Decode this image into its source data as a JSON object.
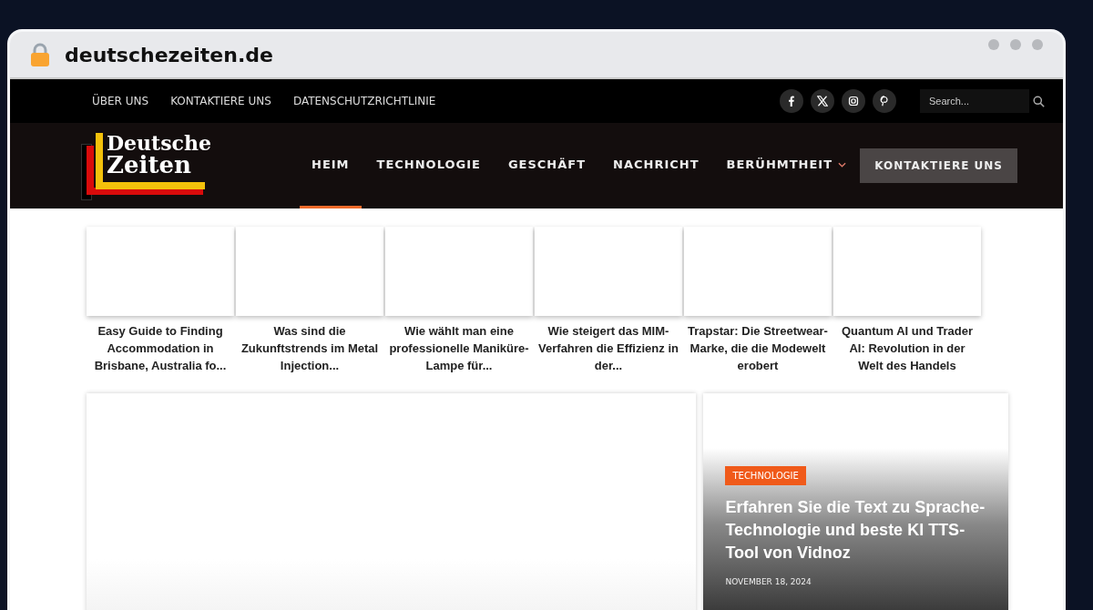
{
  "browser": {
    "address": "deutschezeiten.de"
  },
  "top_bar": {
    "links": [
      "ÜBER UNS",
      "KONTAKTIERE UNS",
      "DATENSCHUTZRICHTLINIE"
    ],
    "social": [
      {
        "kind": "facebook"
      },
      {
        "kind": "x"
      },
      {
        "kind": "instagram"
      },
      {
        "kind": "pinterest"
      }
    ],
    "search": {
      "placeholder": "Search..."
    }
  },
  "header": {
    "logo": [
      "Deutsche",
      "Zeiten"
    ],
    "nav": [
      {
        "label": "HEIM",
        "selected": true,
        "has_menu": false
      },
      {
        "label": "TECHNOLOGIE",
        "selected": false,
        "has_menu": false
      },
      {
        "label": "GESCHÄFT",
        "selected": false,
        "has_menu": false
      },
      {
        "label": "NACHRICHT",
        "selected": false,
        "has_menu": false
      },
      {
        "label": "BERÜHMTHEIT",
        "selected": false,
        "has_menu": true
      }
    ],
    "cta": "KONTAKTIERE UNS"
  },
  "carousel": [
    {
      "title": "Easy Guide to Finding Accommodation in Brisbane, Australia fo..."
    },
    {
      "title": "Was sind die Zukunftstrends im Metal Injection..."
    },
    {
      "title": "Wie wählt man eine professionelle Maniküre-Lampe für..."
    },
    {
      "title": "Wie steigert das MIM-Verfahren die Effizienz in der..."
    },
    {
      "title": "Trapstar: Die Streetwear-Marke, die die Modewelt erobert"
    },
    {
      "title": "Quantum AI und Trader AI: Revolution in der Welt des Handels"
    }
  ],
  "featured": {
    "category": "TECHNOLOGIE",
    "title": "Erfahren Sie die Text zu Sprache-Technologie und beste KI TTS-Tool von Vidnoz",
    "date": "NOVEMBER 18, 2024"
  }
}
